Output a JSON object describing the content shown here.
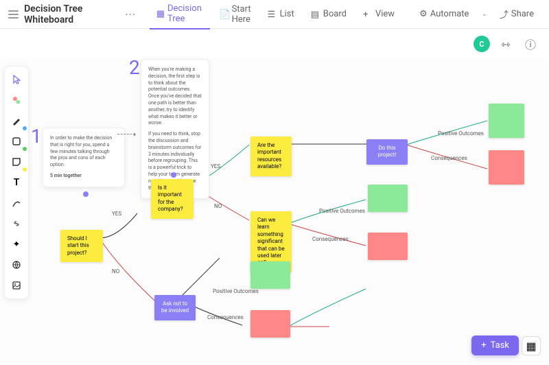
{
  "header": {
    "title": "Decision Tree Whiteboard",
    "tabs": [
      {
        "label": "Decision Tree"
      },
      {
        "label": "Start Here"
      },
      {
        "label": "List"
      },
      {
        "label": "Board"
      },
      {
        "label": "View"
      }
    ],
    "automate": "Automate",
    "share": "Share",
    "avatar": "C"
  },
  "notes": {
    "n1_num": "1",
    "n1_text": "In order to make the decision that is right for you, spend a few minutes talking through the pros and cons of each option.",
    "n1_sub": "5 min together",
    "n2_num": "2",
    "n2_text1": "When you're making a decision, the first step is to think about the potential outcomes. Once you've decided that one path is better than another, try to identify what makes it better or worse.",
    "n2_text2": "If you need to think, stop the discussion and brainstorm outcomes for 3 minutes individually before regrouping. This is a powerful trick to help your team generate new ideas and bounce them off each other."
  },
  "nodes": {
    "start": "Should I start this project?",
    "important": "Is it important for the company?",
    "resources": "Are the important resources available?",
    "ask_not": "Ask not to be involved",
    "learn": "Can we learn something significant that can be used later on?",
    "do_project": "Do this project!"
  },
  "labels": {
    "yes": "YES",
    "no": "NO",
    "positive": "Positive Outcomes",
    "consequences": "Consequences"
  },
  "task_btn": "Task"
}
